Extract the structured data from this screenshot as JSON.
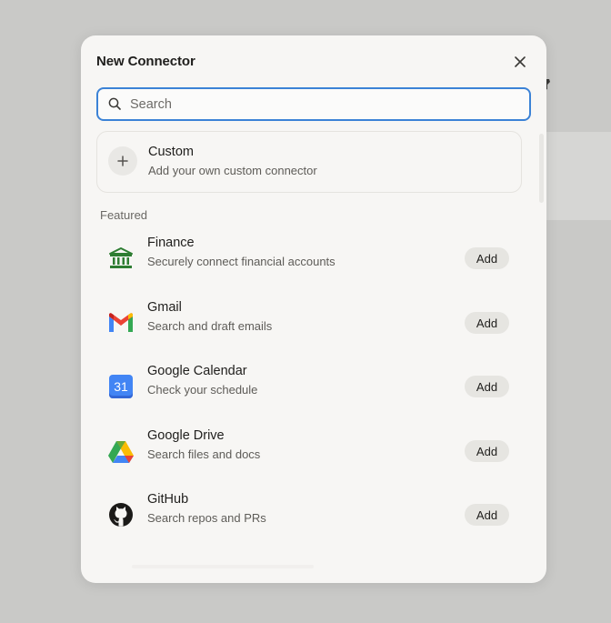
{
  "dialog": {
    "title": "New Connector",
    "close_icon": "close-icon"
  },
  "search": {
    "placeholder": "Search",
    "value": "",
    "icon": "search-icon",
    "focus_color": "#3b82d6"
  },
  "custom": {
    "icon": "plus-icon",
    "name": "Custom",
    "description": "Add your own custom connector"
  },
  "featured": {
    "label": "Featured",
    "items": [
      {
        "icon": "bank-icon",
        "name": "Finance",
        "description": "Securely connect financial accounts",
        "action": "Add"
      },
      {
        "icon": "gmail-icon",
        "name": "Gmail",
        "description": "Search and draft emails",
        "action": "Add"
      },
      {
        "icon": "google-calendar-icon",
        "icon_text": "31",
        "name": "Google Calendar",
        "description": "Check your schedule",
        "action": "Add"
      },
      {
        "icon": "google-drive-icon",
        "name": "Google Drive",
        "description": "Search files and docs",
        "action": "Add"
      },
      {
        "icon": "github-icon",
        "name": "GitHub",
        "description": "Search repos and PRs",
        "action": "Add"
      }
    ]
  },
  "colors": {
    "finance_green": "#2e7d32",
    "calendar_blue": "#4285f4"
  }
}
